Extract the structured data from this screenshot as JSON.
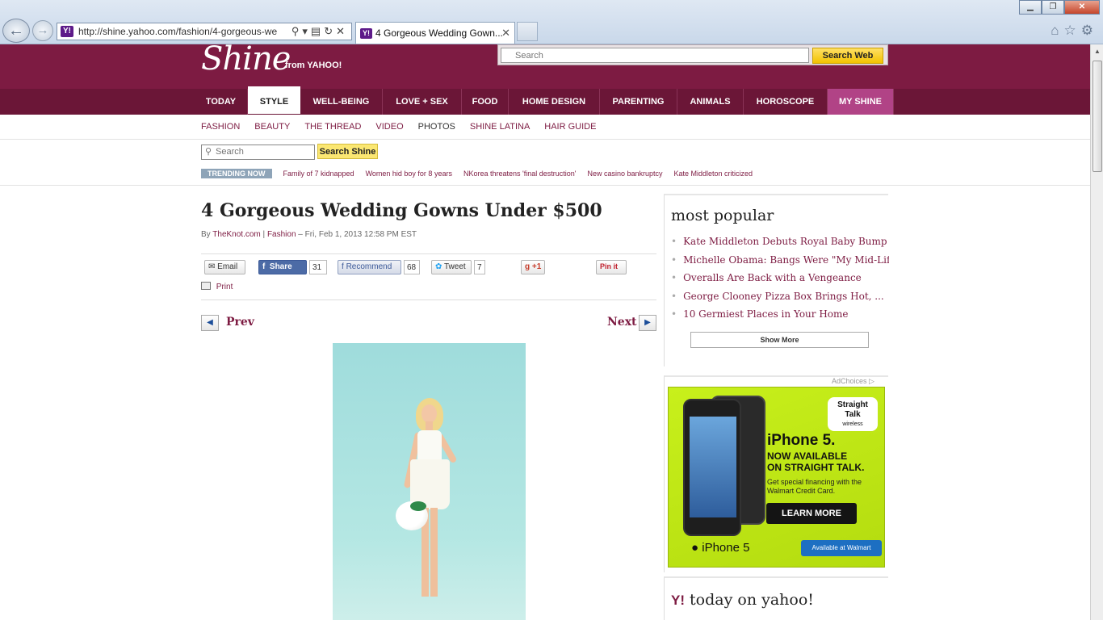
{
  "browser": {
    "url": "http://shine.yahoo.com/fashion/4-gorgeous-we",
    "tab_title": "4 Gorgeous Wedding Gown...",
    "favicon_text": "Y!",
    "minimize": "▁",
    "maximize": "❐",
    "close": "✕"
  },
  "header": {
    "logo": "Shine",
    "logo_from": "from YAHOO!",
    "search_placeholder": "Search",
    "search_button": "Search Web"
  },
  "nav": {
    "items": [
      "TODAY",
      "STYLE",
      "WELL-BEING",
      "LOVE + SEX",
      "FOOD",
      "HOME DESIGN",
      "PARENTING",
      "ANIMALS",
      "HOROSCOPE",
      "MY SHINE"
    ],
    "active": "STYLE"
  },
  "subnav": [
    "FASHION",
    "BEAUTY",
    "THE THREAD",
    "VIDEO",
    "PHOTOS",
    "SHINE LATINA",
    "HAIR GUIDE"
  ],
  "search_shine": {
    "placeholder": "Search",
    "button": "Search Shine"
  },
  "trending": {
    "label": "TRENDING NOW",
    "links": [
      "Family of 7 kidnapped",
      "Women hid boy for 8 years",
      "NKorea threatens 'final destruction'",
      "New casino bankruptcy",
      "Kate Middleton criticized"
    ]
  },
  "article": {
    "title": "4 Gorgeous Wedding Gowns Under $500",
    "by_prefix": "By",
    "author": "TheKnot.com",
    "separator": "|",
    "category": "Fashion",
    "date": "– Fri, Feb 1, 2013 12:58 PM EST"
  },
  "share": {
    "email": "Email",
    "fb_share": "Share",
    "fb_share_count": "31",
    "fb_recommend": "Recommend",
    "fb_recommend_count": "68",
    "tweet": "Tweet",
    "tweet_count": "7",
    "gplus": "+1",
    "pinit": "Pin it",
    "print": "Print"
  },
  "pager": {
    "prev": "Prev",
    "next": "Next"
  },
  "most_popular": {
    "title": "most popular",
    "items": [
      "Kate Middleton Debuts Royal Baby Bump ...",
      "Michelle Obama: Bangs Were \"My Mid-Life ...",
      "Overalls Are Back with a Vengeance",
      "George Clooney Pizza Box Brings Hot, ...",
      "10 Germiest Places in Your Home"
    ],
    "show_more": "Show More"
  },
  "ad": {
    "adchoices": "AdChoices",
    "brand_line1": "Straight",
    "brand_line2": "Talk",
    "brand_line3": "wireless",
    "headline": "iPhone 5.",
    "line1": "NOW AVAILABLE",
    "line2": "ON STRAIGHT TALK.",
    "financing": "Get special financing with the Walmart Credit Card.",
    "cta": "LEARN MORE",
    "product": "iPhone 5",
    "retailer": "Available at Walmart"
  },
  "today_on_yahoo": {
    "logo": "Y!",
    "title": "today on yahoo!"
  },
  "colors": {
    "brand": "#7d1b42",
    "nav": "#6b1637",
    "my_shine": "#b14386",
    "search_button": "#f2c200",
    "ad_green": "#c8f01b"
  }
}
